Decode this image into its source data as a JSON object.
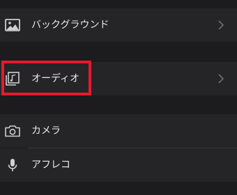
{
  "menu": {
    "background": {
      "label": "バックグラウンド",
      "icon": "image-icon",
      "has_chevron": true
    },
    "audio": {
      "label": "オーディオ",
      "icon": "music-file-icon",
      "has_chevron": true,
      "highlighted": true
    },
    "camera": {
      "label": "カメラ",
      "icon": "camera-icon",
      "has_chevron": false
    },
    "voiceover": {
      "label": "アフレコ",
      "icon": "microphone-icon",
      "has_chevron": false
    }
  },
  "colors": {
    "screen_bg": "#1c1c1e",
    "row_bg": "#252527",
    "text": "#e9e9eb",
    "icon": "#d0d0d2",
    "chevron": "#6e6e72",
    "highlight": "#e8192c"
  }
}
